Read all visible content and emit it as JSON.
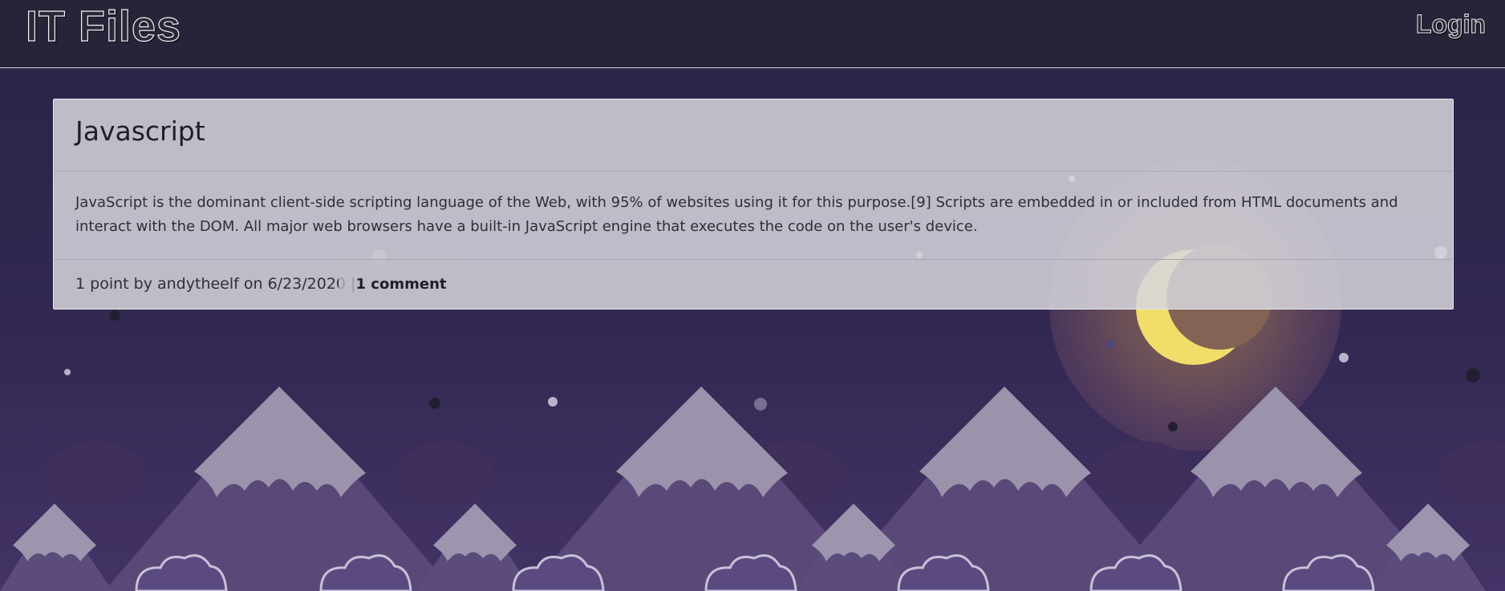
{
  "header": {
    "brand": "IT Files",
    "login_label": "Login"
  },
  "post": {
    "title": "Javascript",
    "body": "JavaScript is the dominant client-side scripting language of the Web, with 95% of websites using it for this purpose.[9] Scripts are embedded in or included from HTML documents and interact with the DOM. All major web browsers have a built-in JavaScript engine that executes the code on the user's device.",
    "points": "1 point",
    "by_label": "by",
    "author": "andytheelf",
    "on_label": "on",
    "date": "6/23/2020",
    "separator": "|",
    "comments_label": "1 comment"
  },
  "colors": {
    "topbar": "#262438",
    "sky_top": "#2b2546",
    "sky_bottom": "#3d2f5e",
    "card": "#d6d5dc",
    "moon": "#f3e06a"
  },
  "background": {
    "icons": [
      "moon-icon",
      "mountain-icon",
      "cloud-icon",
      "star-icon"
    ]
  }
}
